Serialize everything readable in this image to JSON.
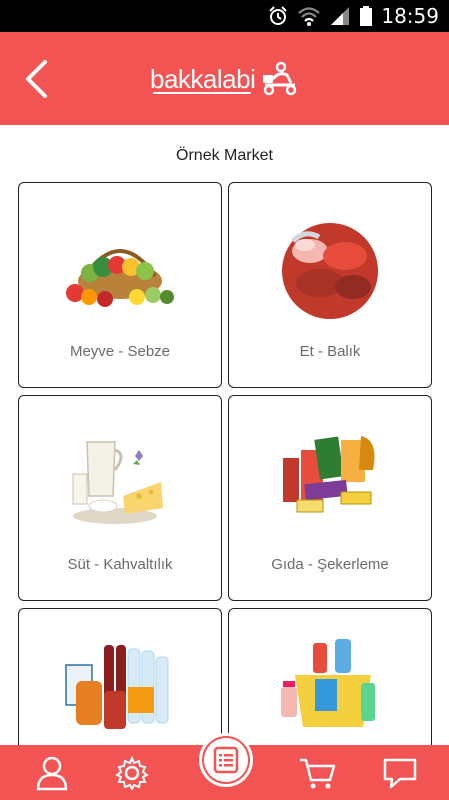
{
  "status_bar": {
    "time": "18:59",
    "icons": [
      "alarm-icon",
      "wifi-icon",
      "signal-icon",
      "battery-icon"
    ]
  },
  "header": {
    "logo_text": "bakkalabi",
    "back_icon": "chevron-left-icon",
    "background": "#f25353"
  },
  "store": {
    "title": "Örnek Market"
  },
  "categories": [
    {
      "label": "Meyve - Sebze",
      "icon": "fruit-basket-image"
    },
    {
      "label": "Et - Balık",
      "icon": "meat-fish-image"
    },
    {
      "label": "Süt - Kahvaltılık",
      "icon": "dairy-breakfast-image"
    },
    {
      "label": "Gıda - Şekerleme",
      "icon": "food-candy-image"
    },
    {
      "label": "",
      "icon": "beverages-image"
    },
    {
      "label": "",
      "icon": "cleaning-supplies-image"
    }
  ],
  "bottom_nav": [
    {
      "icon": "user-icon"
    },
    {
      "icon": "gear-icon"
    },
    {
      "icon": "list-icon"
    },
    {
      "icon": "cart-icon"
    },
    {
      "icon": "chat-icon"
    }
  ],
  "colors": {
    "accent": "#f25353",
    "card_border": "#222222",
    "label_gray": "#6b6b6b"
  }
}
